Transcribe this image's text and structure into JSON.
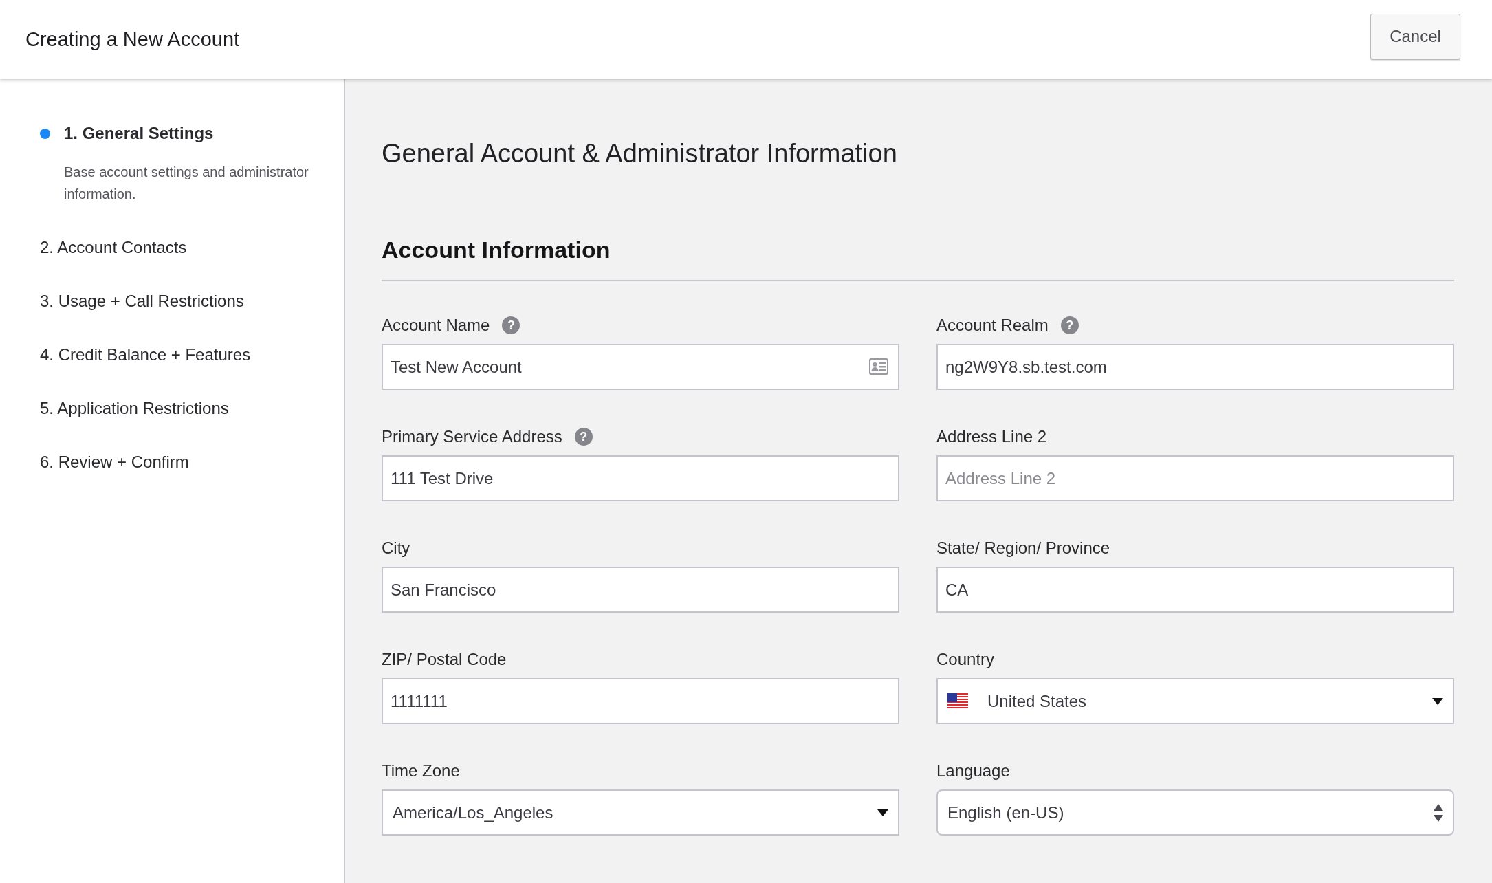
{
  "header": {
    "title": "Creating a New Account",
    "cancel_button": "Cancel"
  },
  "steps": [
    {
      "label": "1. General Settings",
      "selected": true,
      "description": "Base account settings and administrator information."
    },
    {
      "label": "2. Account Contacts",
      "selected": false
    },
    {
      "label": "3. Usage + Call Restrictions",
      "selected": false
    },
    {
      "label": "4. Credit Balance + Features",
      "selected": false
    },
    {
      "label": "5. Application Restrictions",
      "selected": false
    },
    {
      "label": "6. Review + Confirm",
      "selected": false
    }
  ],
  "page_title": "General Account & Administrator Information",
  "section_title": "Account Information",
  "fields": [
    {
      "kind": "card-input",
      "label": "Account Name",
      "help_icon": "?",
      "value": "Test New Account"
    },
    {
      "kind": "input",
      "label": "Account Realm",
      "help_icon": "?",
      "value": "ng2W9Y8.sb.test.com"
    },
    {
      "kind": "input",
      "label": "Primary Service Address",
      "help_icon": "?",
      "value": "111 Test Drive"
    },
    {
      "kind": "input",
      "label": "Address Line 2",
      "placeholder": "Address Line 2"
    },
    {
      "kind": "input",
      "label": "City",
      "value": "San Francisco"
    },
    {
      "kind": "input",
      "label": "State/ Region/ Province",
      "value": "CA"
    },
    {
      "kind": "input",
      "label": "ZIP/ Postal Code",
      "value": "1111111"
    },
    {
      "kind": "country-select",
      "label": "Country",
      "value": "United States"
    },
    {
      "kind": "select",
      "label": "Time Zone",
      "value": "America/Los_Angeles"
    },
    {
      "kind": "stepper-select",
      "label": "Language",
      "value": "English (en-US)"
    }
  ]
}
